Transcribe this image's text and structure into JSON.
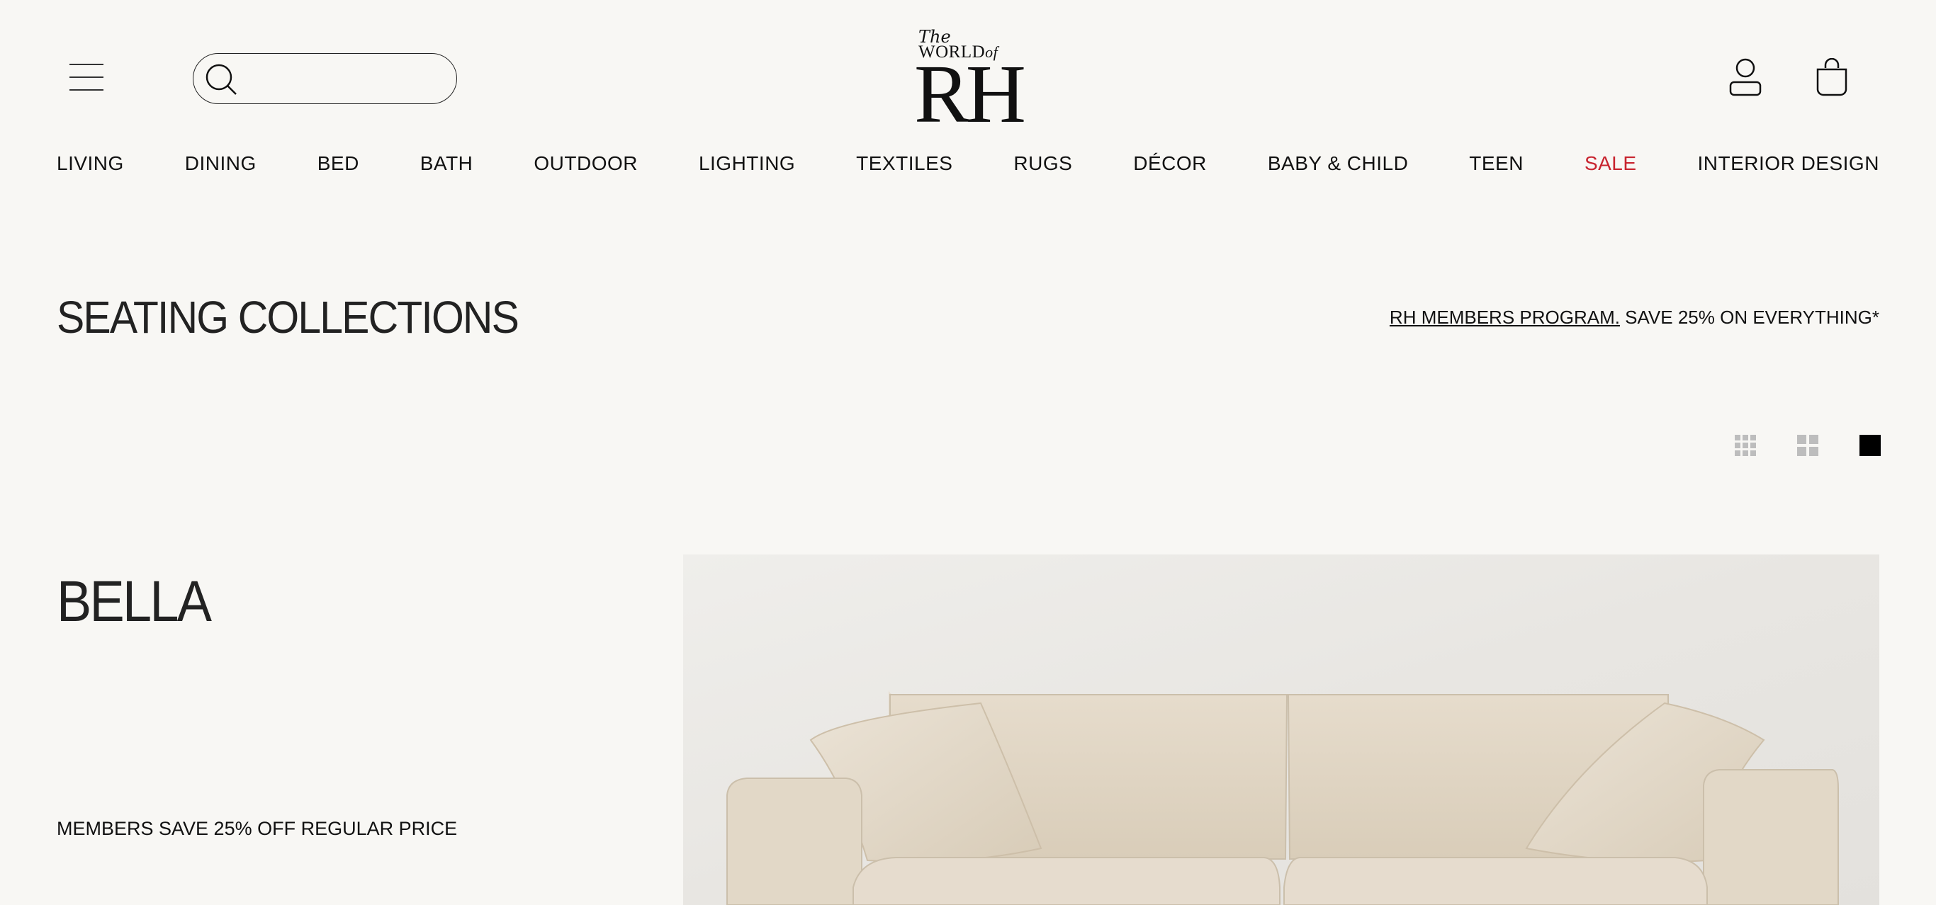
{
  "header": {
    "logo": {
      "the": "The",
      "world": "WORLD",
      "of": "of",
      "rh": "RH"
    },
    "search": {
      "placeholder": "",
      "value": ""
    }
  },
  "nav": {
    "items": [
      "LIVING",
      "DINING",
      "BED",
      "BATH",
      "OUTDOOR",
      "LIGHTING",
      "TEXTILES",
      "RUGS",
      "DÉCOR",
      "BABY & CHILD",
      "TEEN",
      "SALE",
      "INTERIOR DESIGN"
    ]
  },
  "page": {
    "title": "SEATING COLLECTIONS",
    "members_link": "RH MEMBERS PROGRAM.",
    "members_text": " SAVE 25% ON EVERYTHING*"
  },
  "collection": {
    "name": "BELLA",
    "promo": "MEMBERS SAVE 25% OFF REGULAR PRICE"
  },
  "colors": {
    "background": "#f8f7f4",
    "sale": "#c8242f",
    "text": "#111111"
  }
}
